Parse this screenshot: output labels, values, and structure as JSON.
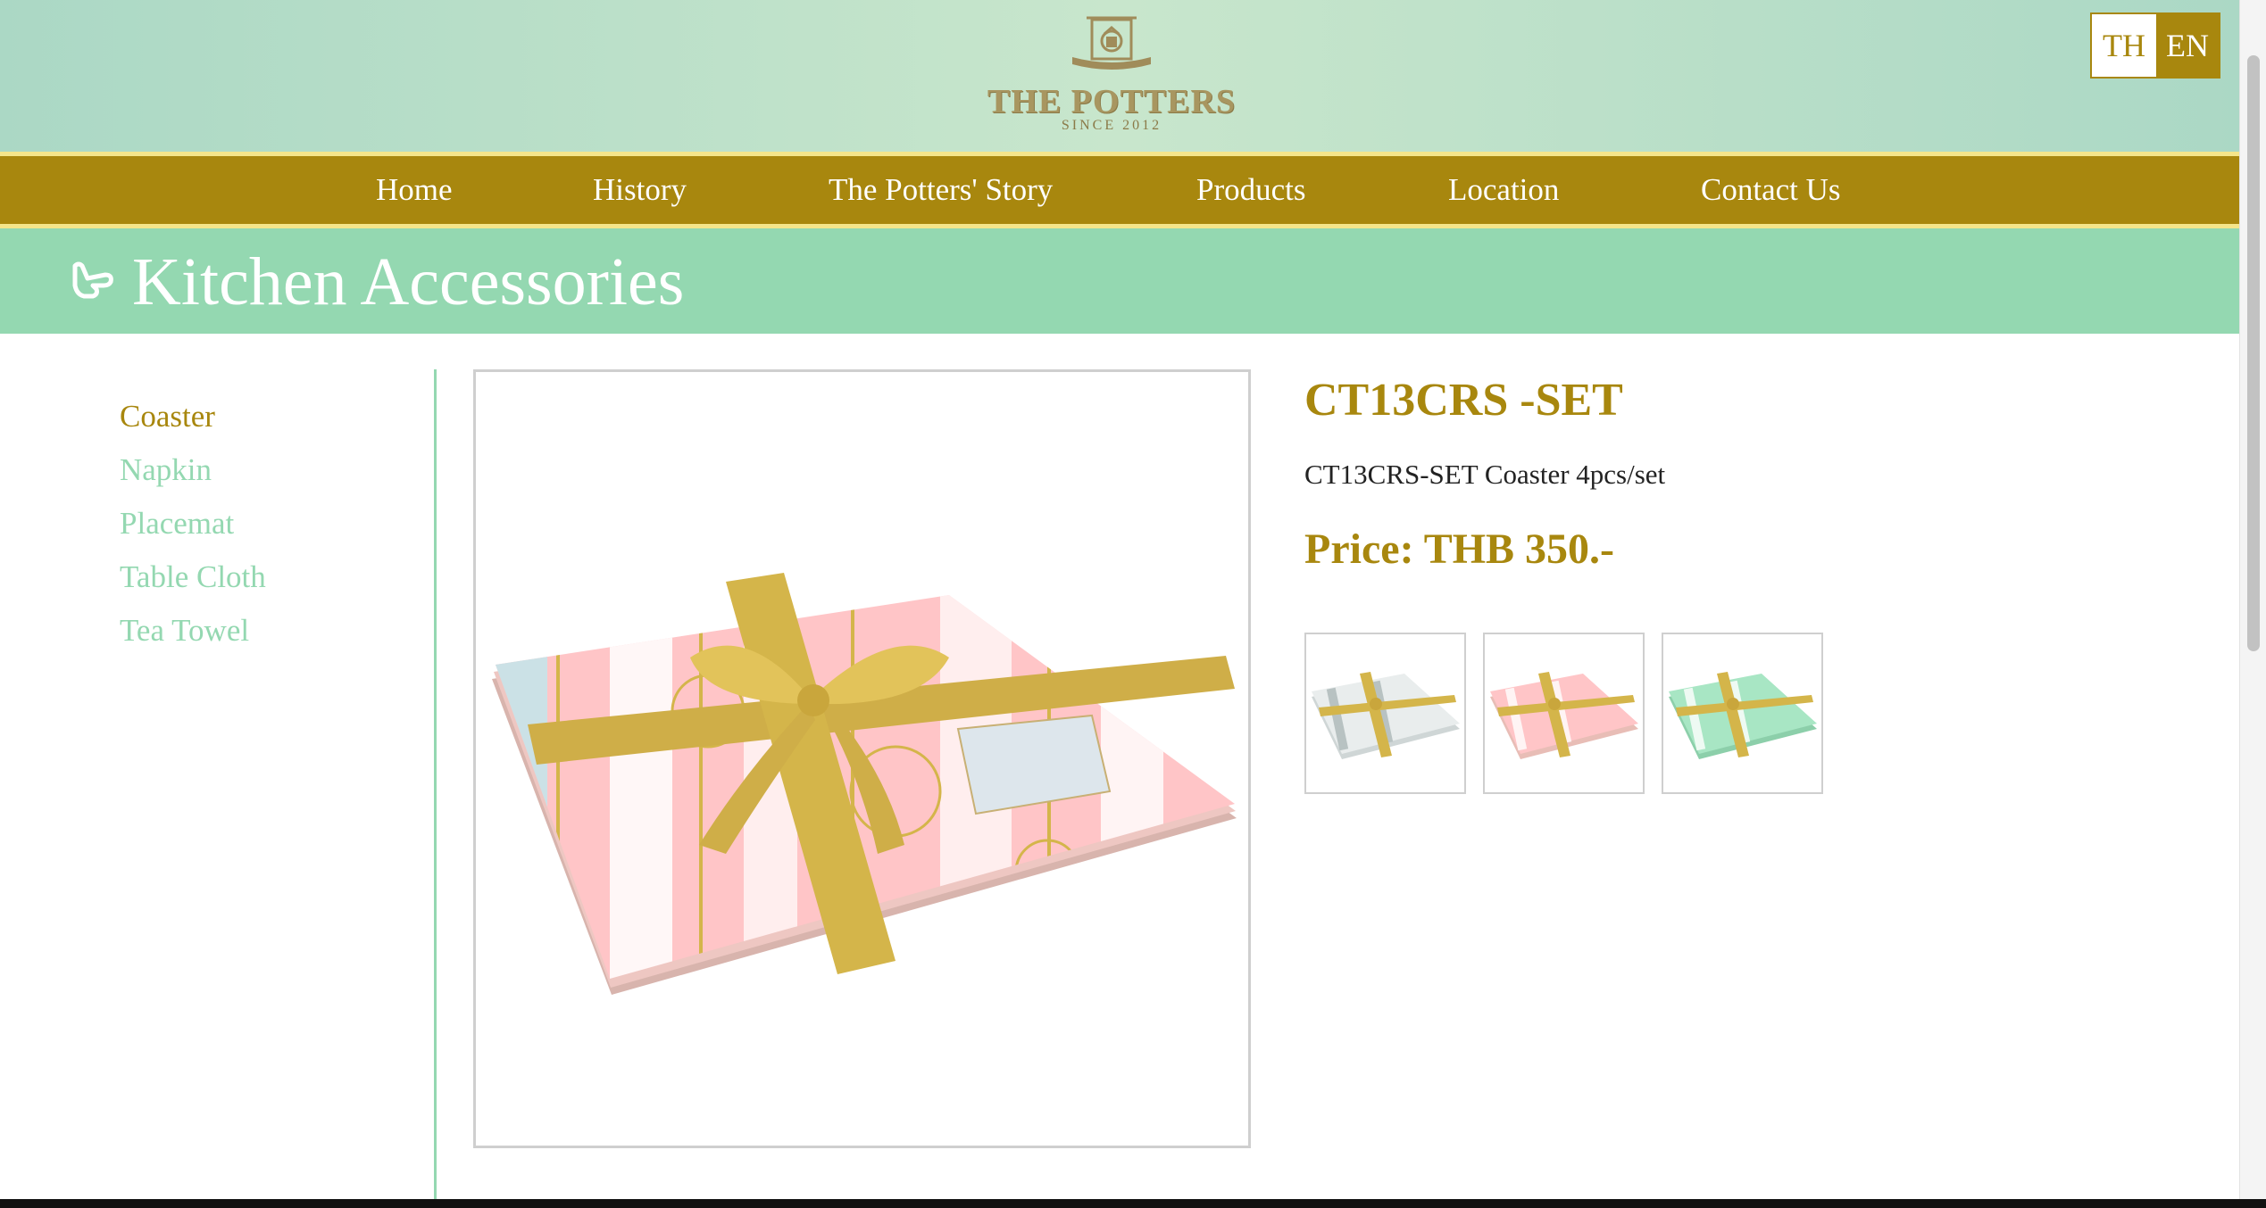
{
  "brand": {
    "name": "THE POTTERS",
    "since": "SINCE 2012"
  },
  "language": {
    "th_label": "TH",
    "en_label": "EN",
    "active": "EN"
  },
  "nav": {
    "items": [
      {
        "label": "Home"
      },
      {
        "label": "History"
      },
      {
        "label": "The Potters' Story"
      },
      {
        "label": "Products"
      },
      {
        "label": "Location"
      },
      {
        "label": "Contact Us"
      }
    ]
  },
  "page": {
    "title": "Kitchen Accessories"
  },
  "sidebar": {
    "items": [
      {
        "label": "Coaster",
        "active": true
      },
      {
        "label": "Napkin",
        "active": false
      },
      {
        "label": "Placemat",
        "active": false
      },
      {
        "label": "Table Cloth",
        "active": false
      },
      {
        "label": "Tea Towel",
        "active": false
      }
    ]
  },
  "product": {
    "code": "CT13CRS -SET",
    "description": "CT13CRS-SET Coaster 4pcs/set",
    "price": "Price: THB 350.-",
    "thumbnails": [
      {
        "name": "gray-coaster-set"
      },
      {
        "name": "pink-coaster-set"
      },
      {
        "name": "green-coaster-set"
      }
    ]
  },
  "colors": {
    "gold": "#a8870e",
    "mint": "#94d8b1",
    "header_bg": "#c8e6cc",
    "nav_border": "#f5e58a"
  }
}
